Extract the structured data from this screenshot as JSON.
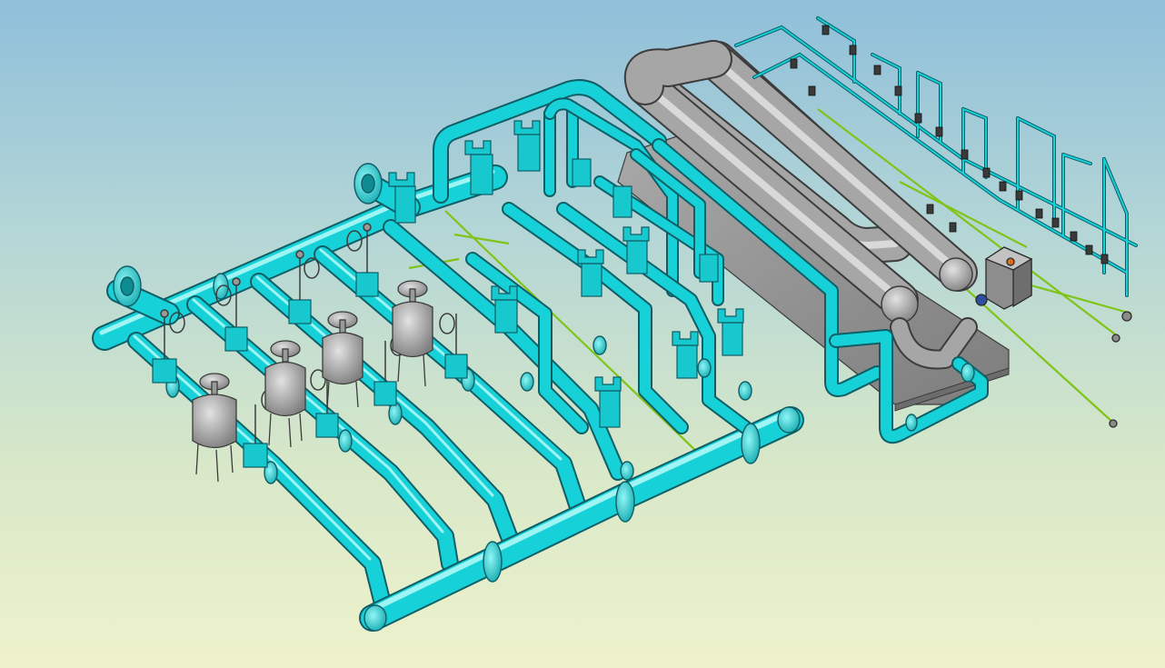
{
  "viewport": {
    "background_top": "#8fbfda",
    "background_bottom": "#eef2cc"
  },
  "colors": {
    "pipe": "#16d2d8",
    "pipe_outline": "#0f5e66",
    "pipe_highlight": "#9ff4f4",
    "equipment": "#a6a6a6",
    "equipment_outline": "#3c3c3c",
    "baseplate": "#8f8f8f",
    "signal_line": "#7fc418"
  },
  "components": {
    "main_headers": [
      "inlet-header",
      "outlet-header"
    ],
    "filters": 4,
    "meter_runs": 5,
    "heat_exchanger": "u-tube-exchanger",
    "control_cabinet": "cabinet-icon",
    "instrument_rack": "instrument-rack-icon"
  }
}
